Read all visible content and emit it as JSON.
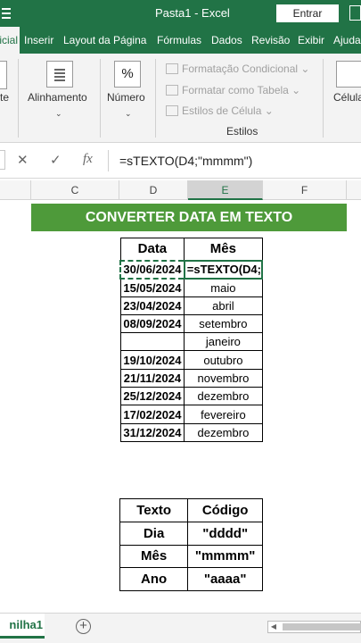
{
  "titlebar": {
    "title": "Pasta1  -  Excel",
    "signin": "Entrar"
  },
  "tabs": [
    "Inserir",
    "Layout da Página",
    "Fórmulas",
    "Dados",
    "Revisão",
    "Exibir",
    "Ajuda"
  ],
  "active_tab": "icial",
  "ribbon": {
    "cut_label": "te",
    "alinhamento": "Alinhamento",
    "numero": "Número",
    "percent_symbol": "%",
    "styles": [
      "Formatação Condicional",
      "Formatar como Tabela",
      "Estilos de Célula"
    ],
    "styles_group": "Estilos",
    "celulas": "Célula"
  },
  "formula_bar": {
    "cancel": "✕",
    "enter": "✓",
    "fx": "fx",
    "formula": "=sTEXTO(D4;\"mmmm\")"
  },
  "columns": [
    "C",
    "D",
    "E",
    "F"
  ],
  "banner": "CONVERTER DATA EM TEXTO",
  "table1": {
    "headers": [
      "Data",
      "Mês"
    ],
    "rows": [
      [
        "30/06/2024",
        "=sTEXTO(D4;"
      ],
      [
        "15/05/2024",
        "maio"
      ],
      [
        "23/04/2024",
        "abril"
      ],
      [
        "08/09/2024",
        "setembro"
      ],
      [
        "",
        "janeiro"
      ],
      [
        "19/10/2024",
        "outubro"
      ],
      [
        "21/11/2024",
        "novembro"
      ],
      [
        "25/12/2024",
        "dezembro"
      ],
      [
        "17/02/2024",
        "fevereiro"
      ],
      [
        "31/12/2024",
        "dezembro"
      ]
    ]
  },
  "table2": {
    "headers": [
      "Texto",
      "Código"
    ],
    "rows": [
      [
        "Dia",
        "\"dddd\""
      ],
      [
        "Mês",
        "\"mmmm\""
      ],
      [
        "Ano",
        "\"aaaa\""
      ]
    ]
  },
  "sheet_tab": "nilha1",
  "add_sheet": "+",
  "colors": {
    "excel_green": "#217346",
    "banner_green": "#4e9a3a"
  }
}
